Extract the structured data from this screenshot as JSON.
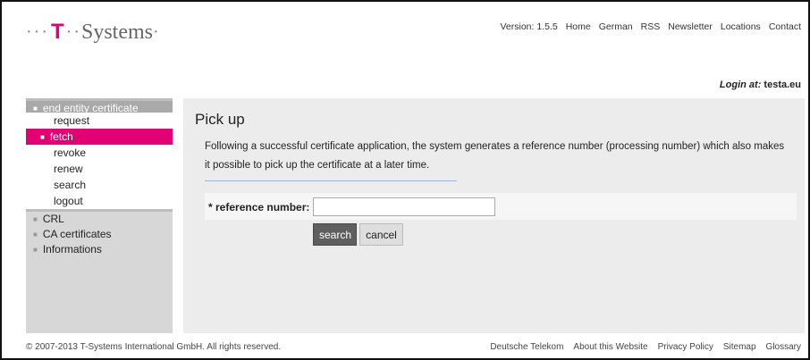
{
  "logo": {
    "dots_left": "···",
    "t_letter": "T",
    "dots_mid": "··",
    "text": "Systems",
    "dot_right": "·"
  },
  "topnav": {
    "items": [
      "Version: 1.5.5",
      "Home",
      "German",
      "RSS",
      "Newsletter",
      "Locations",
      "Contact"
    ]
  },
  "login": {
    "label": "Login at:",
    "value": "testa.eu"
  },
  "sidebar": {
    "group_title": "end entity certificate",
    "sub_items": [
      "request",
      "fetch",
      "revoke",
      "renew",
      "search",
      "logout"
    ],
    "active_sub": "fetch",
    "items": [
      "CRL",
      "CA certificates",
      "Informations"
    ],
    "bullet_glyph": "■"
  },
  "main": {
    "title": "Pick up",
    "intro": "Following a successful certificate application, the system generates a reference number (processing number) which also makes it possible to pick up the certificate at a later time.",
    "form": {
      "label": "* reference number:",
      "value": "",
      "placeholder": ""
    },
    "buttons": {
      "search": "search",
      "cancel": "cancel"
    }
  },
  "footer": {
    "copyright": "© 2007-2013 T-Systems International GmbH. All rights reserved.",
    "links": [
      "Deutsche Telekom",
      "About this Website",
      "Privacy Policy",
      "Sitemap",
      "Glossary"
    ]
  },
  "colors": {
    "magenta": "#e20074",
    "sidebar_bg": "#d7d7d7",
    "main_bg": "#ececec",
    "group_title_bg": "#a9a9a9",
    "button_dark": "#5f5f5f"
  }
}
